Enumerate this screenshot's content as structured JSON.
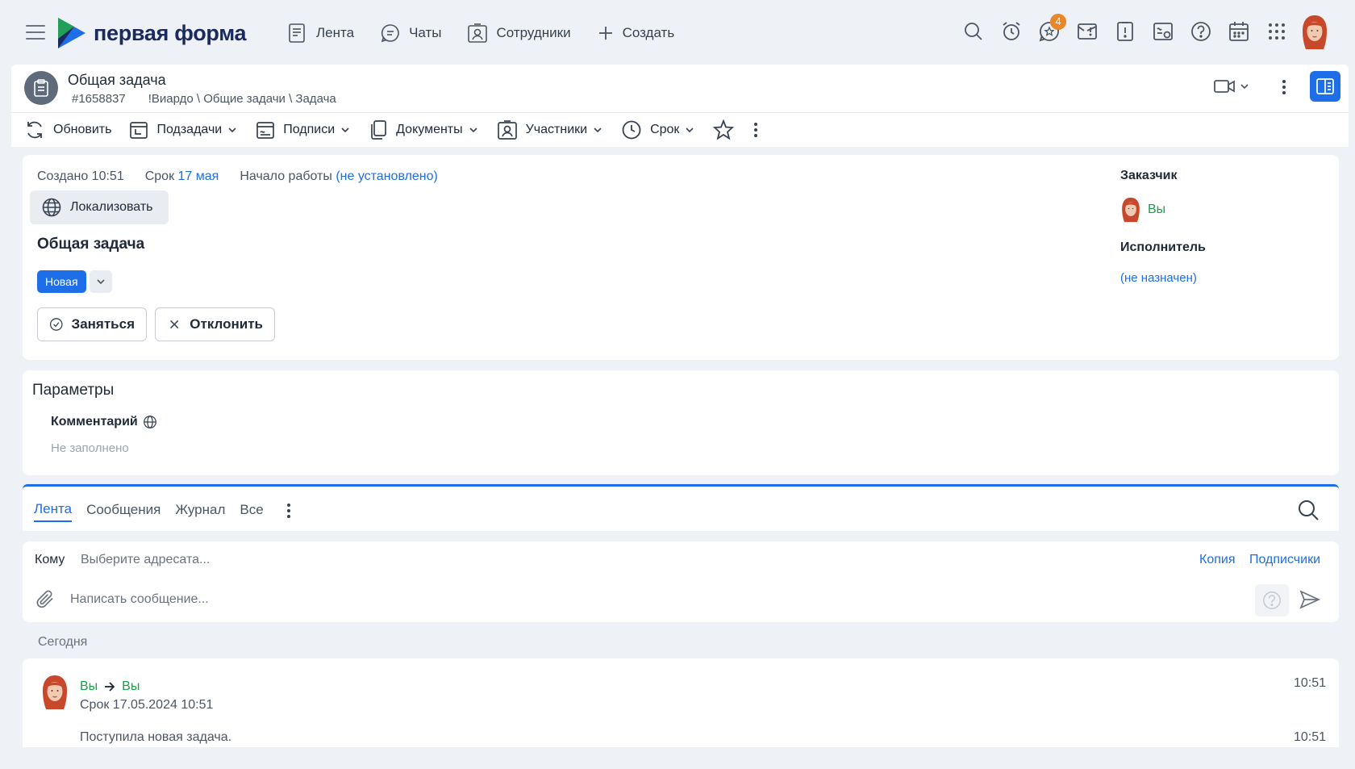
{
  "app": {
    "brand": "первая форма",
    "nav": [
      {
        "label": "Лента",
        "icon": "feed-icon"
      },
      {
        "label": "Чаты",
        "icon": "chat-icon"
      },
      {
        "label": "Сотрудники",
        "icon": "employees-icon"
      },
      {
        "label": "Создать",
        "icon": "plus-icon"
      }
    ],
    "notification_count": "4"
  },
  "task": {
    "title": "Общая задача",
    "id": "#1658837",
    "path": "!Виардо \\ Общие задачи \\ Задача"
  },
  "toolbar": {
    "refresh": "Обновить",
    "subtasks": "Подзадачи",
    "signatures": "Подписи",
    "documents": "Документы",
    "participants": "Участники",
    "deadline": "Срок"
  },
  "info": {
    "created": "Создано 10:51",
    "deadline_label": "Срок",
    "deadline_value": "17 мая",
    "start_label": "Начало работы",
    "start_value": "(не установлено)",
    "localize": "Локализовать",
    "title": "Общая задача",
    "status": "Новая",
    "take_button": "Заняться",
    "reject_button": "Отклонить",
    "customer_label": "Заказчик",
    "customer_value": "Вы",
    "executor_label": "Исполнитель",
    "executor_value": "(не назначен)"
  },
  "params": {
    "title": "Параметры",
    "comment_label": "Комментарий",
    "comment_value": "Не заполнено"
  },
  "feed": {
    "tabs": [
      "Лента",
      "Сообщения",
      "Журнал",
      "Все"
    ],
    "active_tab": 0
  },
  "compose": {
    "to_label": "Кому",
    "to_placeholder": "Выберите адресата...",
    "copy": "Копия",
    "subscribers": "Подписчики",
    "message_placeholder": "Написать сообщение..."
  },
  "messages": {
    "day": "Сегодня",
    "items": [
      {
        "from": "Вы",
        "to": "Вы",
        "subtitle": "Срок 17.05.2024 10:51",
        "time": "10:51",
        "text": "Поступила новая задача.",
        "text_time": "10:51"
      }
    ]
  },
  "colors": {
    "accent": "#1e6ee8",
    "user_green": "#16a34a",
    "badge_orange": "#e8862b",
    "brand_navy": "#1b2a5e"
  }
}
